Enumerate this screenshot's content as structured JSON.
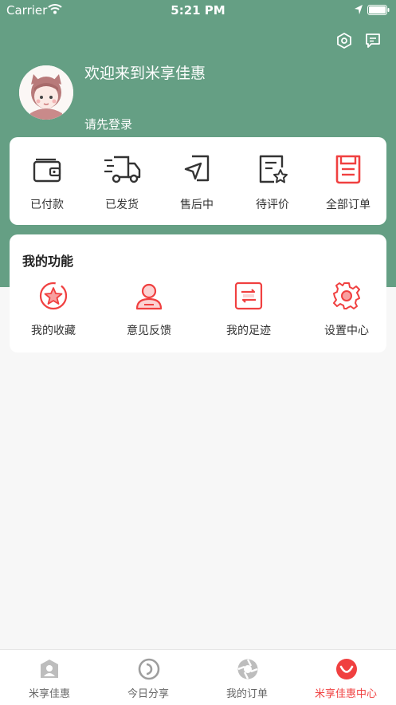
{
  "status_bar": {
    "carrier": "Carrier",
    "time": "5:21 PM"
  },
  "header": {
    "welcome": "欢迎来到米享佳惠",
    "login_prompt": "请先登录",
    "background_color": "#659f84"
  },
  "orders": [
    {
      "label": "已付款",
      "icon": "wallet-icon"
    },
    {
      "label": "已发货",
      "icon": "truck-icon"
    },
    {
      "label": "售后中",
      "icon": "send-icon"
    },
    {
      "label": "待评价",
      "icon": "review-star-icon"
    },
    {
      "label": "全部订单",
      "icon": "order-list-icon"
    }
  ],
  "functions": {
    "title": "我的功能",
    "items": [
      {
        "label": "我的收藏",
        "icon": "star-icon"
      },
      {
        "label": "意见反馈",
        "icon": "user-icon"
      },
      {
        "label": "我的足迹",
        "icon": "footprint-icon"
      },
      {
        "label": "设置中心",
        "icon": "gear-icon"
      }
    ]
  },
  "tabs": [
    {
      "label": "米享佳惠",
      "icon": "home-icon",
      "active": false
    },
    {
      "label": "今日分享",
      "icon": "share-icon",
      "active": false
    },
    {
      "label": "我的订单",
      "icon": "aperture-icon",
      "active": false
    },
    {
      "label": "米享佳惠中心",
      "icon": "smile-icon",
      "active": true
    }
  ],
  "colors": {
    "accent": "#f04040",
    "icon_dark": "#333333",
    "tab_inactive": "#999999"
  }
}
